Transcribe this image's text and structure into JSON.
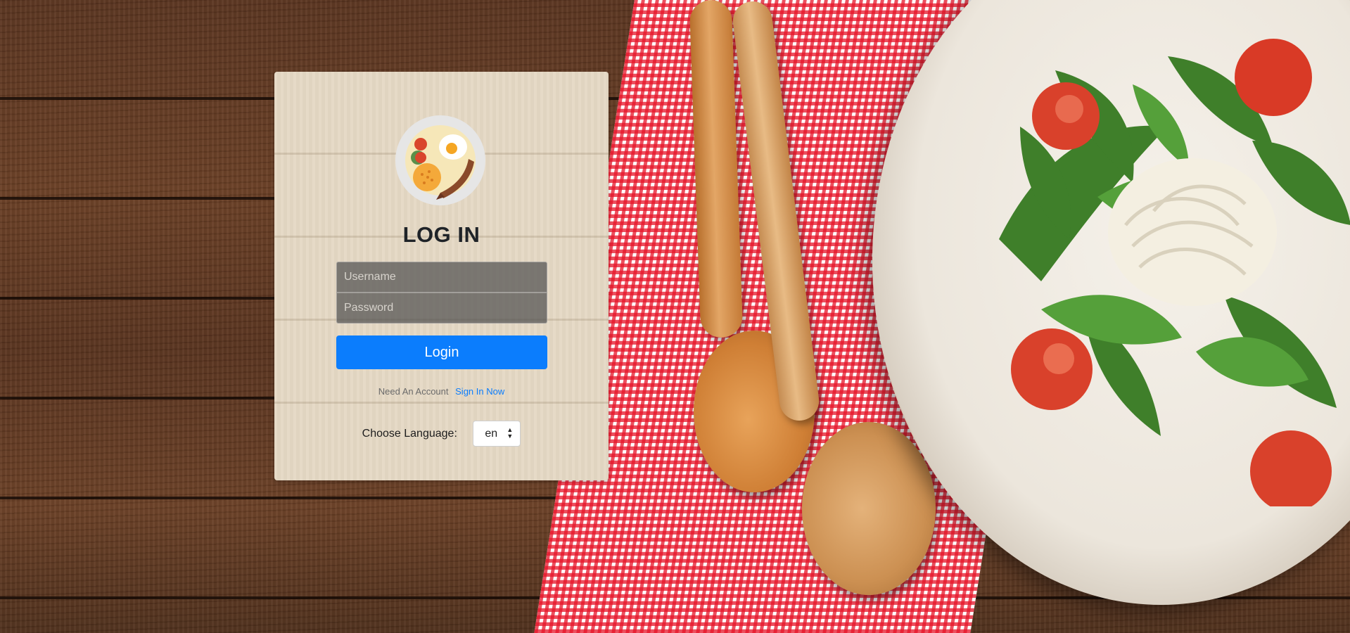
{
  "login_card": {
    "title": "LOG IN",
    "username_placeholder": "Username",
    "password_placeholder": "Password",
    "login_button": "Login",
    "signup_prompt": "Need An Account",
    "signup_link": "Sign In Now",
    "language_label": "Choose Language:",
    "language_value": "en",
    "logo_icon": "breakfast-plate-icon"
  },
  "colors": {
    "accent": "#0b7dfd",
    "card_background": "#e4d8c4",
    "input_background": "#505050",
    "title": "#1f2328"
  },
  "background": {
    "description_icon": "food-table-background"
  }
}
